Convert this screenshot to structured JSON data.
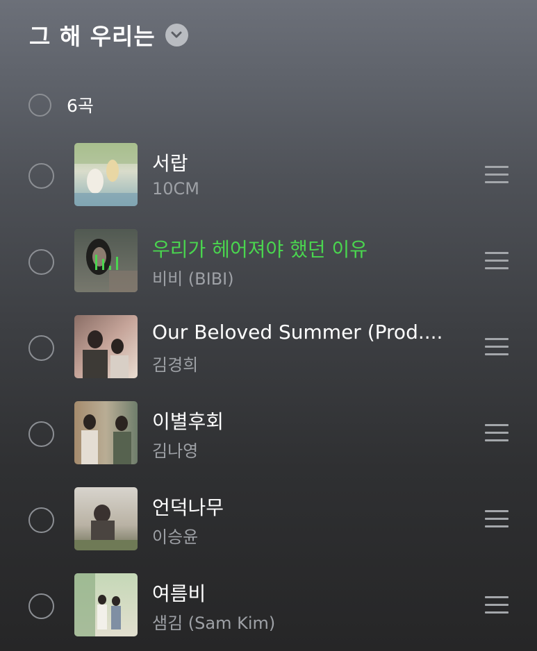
{
  "header": {
    "title": "그 해 우리는",
    "dropdown_icon": "chevron-down-icon"
  },
  "select_all": {
    "count_label": "6곡"
  },
  "colors": {
    "playing": "#4ad64f"
  },
  "tracks": [
    {
      "title": "서랍",
      "artist": "10CM",
      "playing": false
    },
    {
      "title": "우리가 헤어져야 했던 이유",
      "artist": "비비 (BIBI)",
      "playing": true
    },
    {
      "title": "Our Beloved Summer (Prod....",
      "artist": "김경희",
      "playing": false
    },
    {
      "title": "이별후회",
      "artist": "김나영",
      "playing": false
    },
    {
      "title": "언덕나무",
      "artist": "이승윤",
      "playing": false
    },
    {
      "title": "여름비",
      "artist": "샘김 (Sam Kim)",
      "playing": false
    }
  ]
}
